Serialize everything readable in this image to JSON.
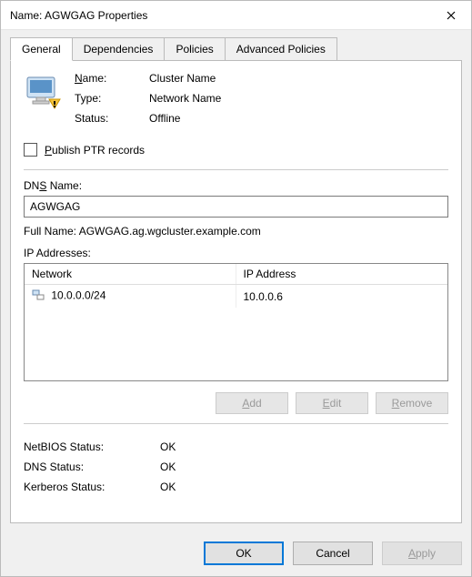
{
  "window": {
    "title": "Name: AGWGAG Properties"
  },
  "tabs": {
    "general": "General",
    "dependencies": "Dependencies",
    "policies": "Policies",
    "advanced_policies": "Advanced Policies"
  },
  "info": {
    "name_label": "Name:",
    "name_value": "Cluster Name",
    "type_label": "Type:",
    "type_value": "Network Name",
    "status_label": "Status:",
    "status_value": "Offline"
  },
  "publish_ptr_label": "Publish PTR records",
  "dns": {
    "label": "DNS Name:",
    "value": "AGWGAG",
    "full_name_label": "Full Name:",
    "full_name_value": "AGWGAG.ag.wgcluster.example.com"
  },
  "ip_section": {
    "label": "IP Addresses:",
    "col_network": "Network",
    "col_ip": "IP Address",
    "rows": [
      {
        "network": "10.0.0.0/24",
        "ip": "10.0.0.6"
      }
    ]
  },
  "buttons": {
    "add": "Add",
    "edit": "Edit",
    "remove": "Remove"
  },
  "status": {
    "netbios_label": "NetBIOS Status:",
    "netbios_value": "OK",
    "dns_label": "DNS Status:",
    "dns_value": "OK",
    "kerberos_label": "Kerberos Status:",
    "kerberos_value": "OK"
  },
  "dialog": {
    "ok": "OK",
    "cancel": "Cancel",
    "apply": "Apply"
  }
}
